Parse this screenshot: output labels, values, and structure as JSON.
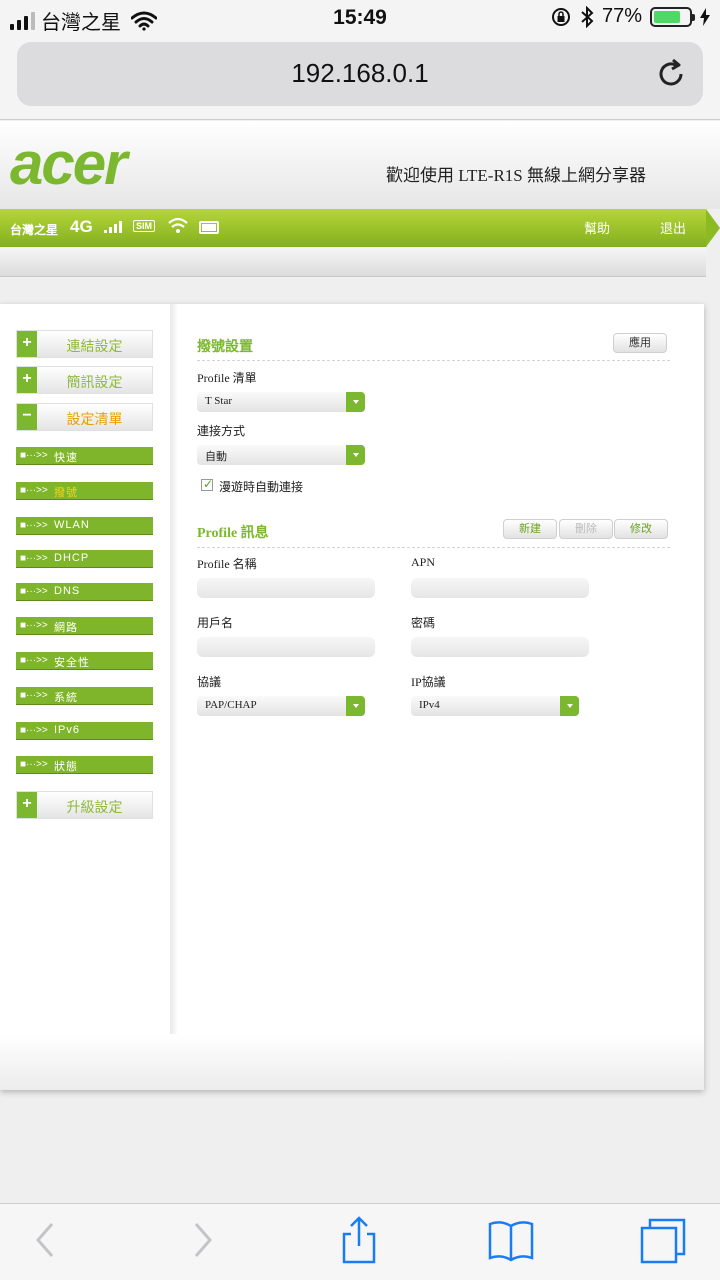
{
  "status_bar": {
    "carrier": "台灣之星",
    "time": "15:49",
    "battery_percent": "77%",
    "battery_level": 0.77
  },
  "browser": {
    "url": "192.168.0.1"
  },
  "router": {
    "logo_text": "acer",
    "welcome": "歡迎使用 LTE-R1S 無線上網分享器",
    "status_carrier": "台灣之星",
    "network_type": "4G",
    "sim_label": "SIM",
    "help": "幫助",
    "logout": "退出"
  },
  "sidebar": {
    "main_items": [
      {
        "toggle": "+",
        "label": "連結設定"
      },
      {
        "toggle": "+",
        "label": "簡訊設定"
      },
      {
        "toggle": "−",
        "label": "設定清單"
      },
      {
        "toggle": "+",
        "label": "升級設定"
      }
    ],
    "sub_prefix": "■···>>",
    "sub_items": [
      {
        "label": "快速"
      },
      {
        "label": "撥號"
      },
      {
        "label": "WLAN"
      },
      {
        "label": "DHCP"
      },
      {
        "label": "DNS"
      },
      {
        "label": "網路"
      },
      {
        "label": "安全性"
      },
      {
        "label": "系統"
      },
      {
        "label": "IPv6"
      },
      {
        "label": "狀態"
      }
    ]
  },
  "dial": {
    "title": "撥號設置",
    "apply": "應用",
    "profile_list_label": "Profile 清單",
    "profile_list_value": "T Star",
    "connect_mode_label": "連接方式",
    "connect_mode_value": "自動",
    "roaming_label": "漫遊時自動連接",
    "roaming_checked": true
  },
  "profile": {
    "title": "Profile 訊息",
    "new": "新建",
    "delete": "刪除",
    "modify": "修改",
    "name_label": "Profile 名稱",
    "apn_label": "APN",
    "username_label": "用戶名",
    "password_label": "密碼",
    "protocol_label": "協議",
    "protocol_value": "PAP/CHAP",
    "ip_protocol_label": "IP協議",
    "ip_protocol_value": "IPv4"
  },
  "icons": {
    "reload": "reload-icon",
    "back": "back-icon",
    "forward": "forward-icon",
    "share": "share-icon",
    "bookmarks": "bookmarks-icon",
    "tabs": "tabs-icon"
  },
  "colors": {
    "brand_green": "#7cb82f",
    "active_orange": "#e8a000",
    "active_sub_yellow": "#f7d21a",
    "ios_blue": "#1a7cf5"
  }
}
